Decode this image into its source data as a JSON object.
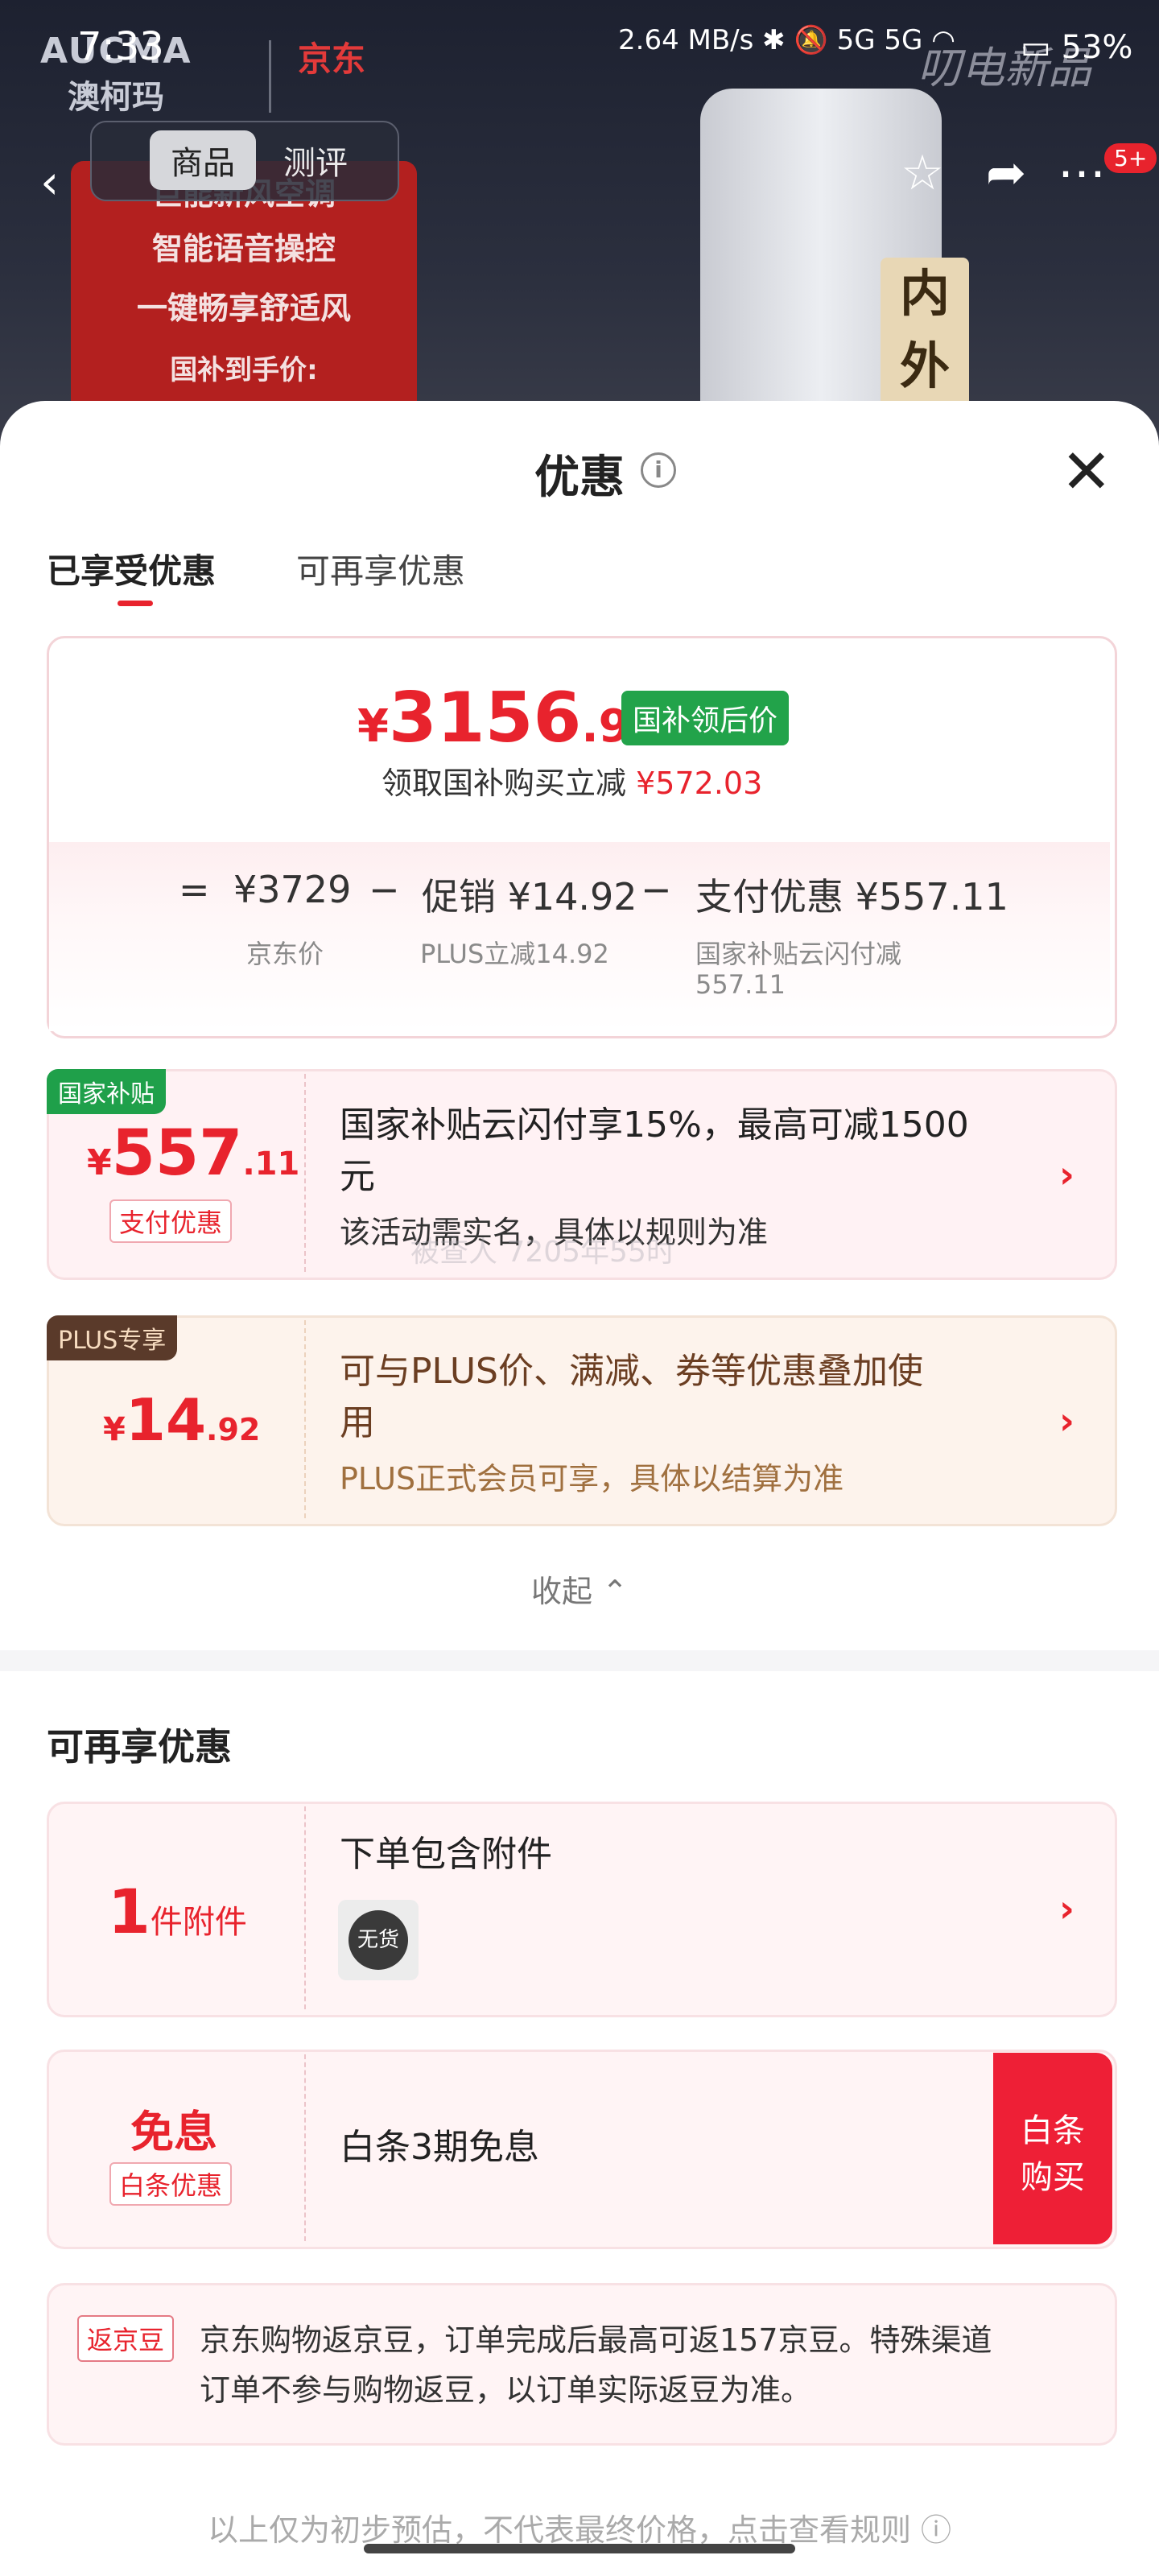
{
  "status_bar": {
    "time": "7:33",
    "speed": "2.64 MB/s",
    "network": "5G 5G",
    "battery": "53%"
  },
  "hero": {
    "brand": "AUCMA",
    "brand_cn": "澳柯玛",
    "partner": "京东",
    "watermark": "叨电新品",
    "promo_lines": [
      "巨能新风空调",
      "智能语音操控",
      "一键畅享舒适风",
      "国补到手价:"
    ],
    "side_tag": "内外"
  },
  "nav": {
    "tabs": [
      "商品",
      "测评"
    ],
    "badge": "5+"
  },
  "sheet": {
    "title": "优惠",
    "close": "✕",
    "tabs": [
      "已享受优惠",
      "可再享优惠"
    ]
  },
  "summary": {
    "yen": "¥",
    "price_int": "3156",
    "price_dec": ".97",
    "price_tag": "国补领后价",
    "sub_text": "领取国补购买立减",
    "sub_amount": "¥572.03",
    "formula": [
      {
        "sym": "=",
        "text": "¥3729",
        "label": "京东价"
      },
      {
        "sym": "−",
        "text": "促销 ¥14.92",
        "label": "PLUS立减14.92"
      },
      {
        "sym": "−",
        "text": "支付优惠 ¥557.11",
        "label": "国家补贴云闪付减",
        "label2": "557.11"
      }
    ]
  },
  "offers": [
    {
      "tag": "国家补贴",
      "yen": "¥",
      "int": "557",
      "dec": ".11",
      "badge": "支付优惠",
      "title_l1": "国家补贴云闪付享15%，最高可减1500",
      "title_l2": "元",
      "desc": "该活动需实名，具体以规则为准"
    },
    {
      "tag": "PLUS专享",
      "yen": "¥",
      "int": "14",
      "dec": ".92",
      "title_l1": "可与PLUS价、满减、券等优惠叠加使",
      "title_l2": "用",
      "desc": "PLUS正式会员可享，具体以结算为准"
    }
  ],
  "collapse": "收起 ⌃",
  "more": {
    "section_title": "可再享优惠",
    "accessory": {
      "count": "1",
      "unit": "件附件",
      "title": "下单包含附件",
      "stock": "无货"
    },
    "baitiao": {
      "label": "免息",
      "badge": "白条优惠",
      "title": "白条3期免息",
      "btn_l1": "白条",
      "btn_l2": "购买"
    },
    "beans": {
      "badge": "返京豆",
      "line1": "京东购物返京豆，订单完成后最高可返157京豆。特殊渠道",
      "line2": "订单不参与购物返豆，以订单实际返豆为准。"
    }
  },
  "footer_note": "以上仅为初步预估，不代表最终价格，点击查看规则 ⓘ",
  "watermark_mid": "被查人 7205年55时"
}
